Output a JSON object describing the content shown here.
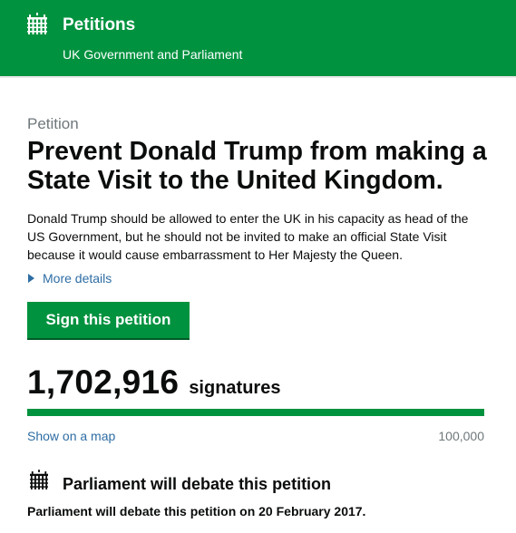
{
  "header": {
    "logo_icon": "portcullis-icon",
    "title": "Petitions",
    "subtitle": "UK Government and Parliament",
    "color": "#00923f"
  },
  "petition": {
    "eyebrow": "Petition",
    "title": "Prevent Donald Trump from making a State Visit to the United Kingdom.",
    "description": "Donald Trump should be allowed to enter the UK in his capacity as head of the US Government, but he should not be invited to make an official State Visit because it would cause embarrassment to Her Majesty the Queen.",
    "more_details_label": "More details",
    "sign_button_label": "Sign this petition"
  },
  "signatures": {
    "count": "1,702,916",
    "label": "signatures",
    "progress_fraction": 1.0,
    "map_link_label": "Show on a map",
    "threshold": "100,000"
  },
  "debate": {
    "icon": "portcullis-icon",
    "title": "Parliament will debate this petition",
    "text": "Parliament will debate this petition on 20 February 2017."
  },
  "colors": {
    "accent": "#00923f",
    "link": "#2e6da4",
    "muted": "#6f777b"
  }
}
